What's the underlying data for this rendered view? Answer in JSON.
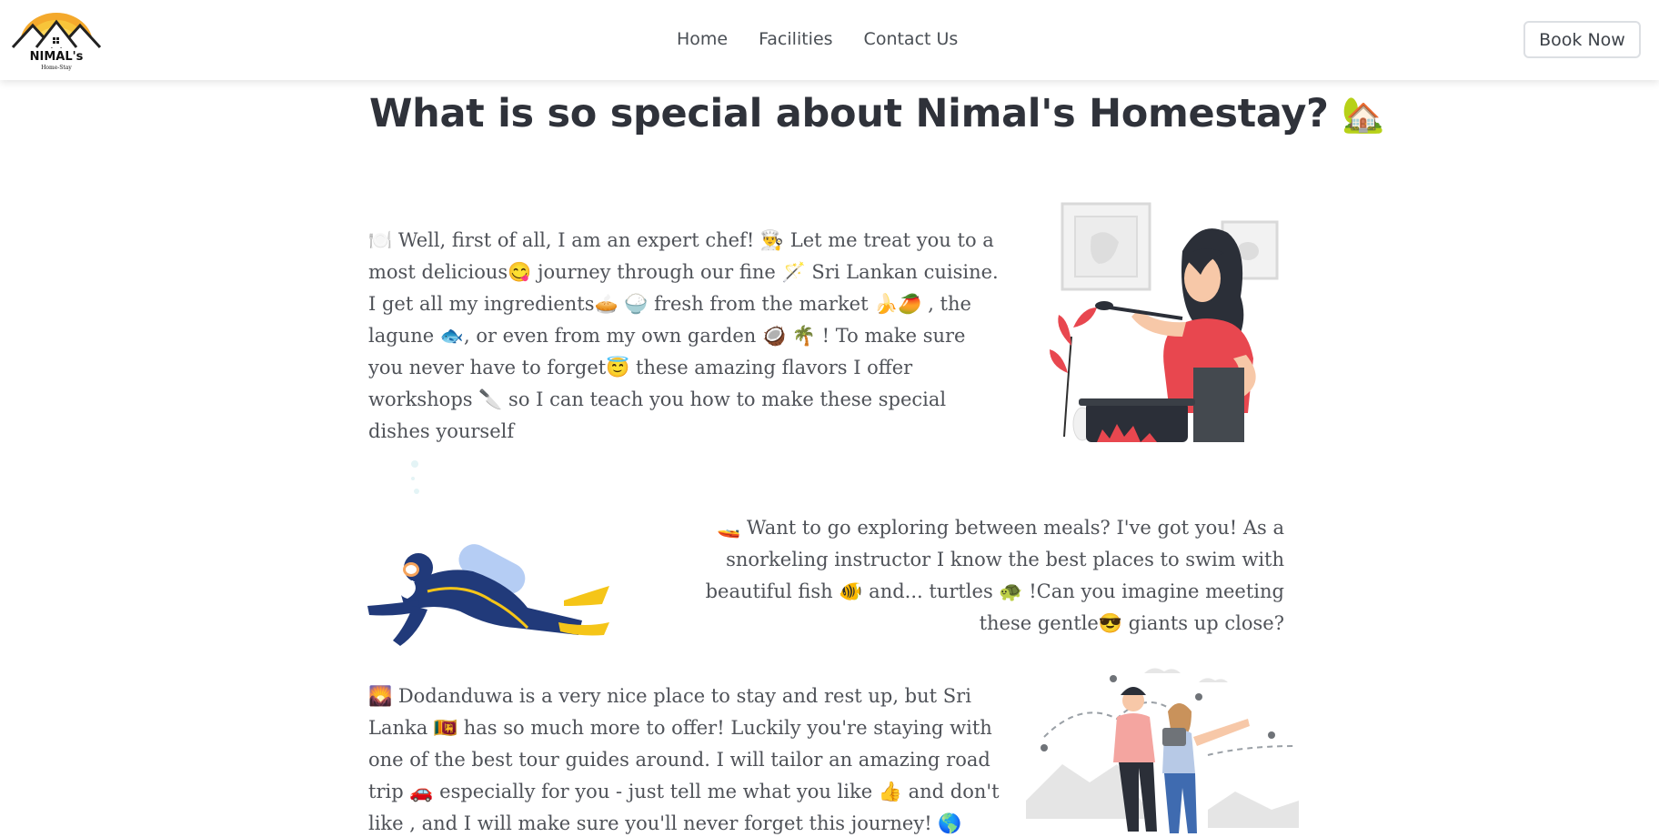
{
  "brand": {
    "name": "NIMAL's",
    "subtitle": "Home-Stay"
  },
  "nav": {
    "items": [
      {
        "label": "Home"
      },
      {
        "label": "Facilities"
      },
      {
        "label": "Contact Us"
      }
    ],
    "book_label": "Book Now"
  },
  "page": {
    "title": "What is so special about Nimal's Homestay?",
    "title_emoji": "🏡"
  },
  "sections": [
    {
      "text": "🍽️ Well, first of all, I am an expert chef! 👨‍🍳 Let me treat you to a most delicious😋 journey through our fine 🪄 Sri Lankan cuisine. I get all my ingredients🥧 🍚 fresh from the market 🍌🥭 , the lagune 🐟, or even from my own garden 🥥 🌴 ! To make sure you never have to forget😇 these amazing flavors I offer workshops 🔪 so I can teach you how to make these special dishes yourself",
      "illustration": "chef-illustration"
    },
    {
      "text": "🚤 Want to go exploring between meals? I've got you! As a snorkeling instructor I know the best places to swim with beautiful fish 🐠 and... turtles 🐢 !Can you imagine meeting these gentle😎 giants up close?",
      "illustration": "diver-illustration"
    },
    {
      "text": "🌄 Dodanduwa is a very nice place to stay and rest up, but Sri Lanka 🇱🇰 has so much more to offer! Luckily you're staying with one of the best tour guides around. I will tailor an amazing road trip 🚗 especially for you - just tell me what you like 👍 and don't like , and I will make sure you'll never forget this journey! 🌎",
      "illustration": "travel-illustration"
    }
  ],
  "colors": {
    "heading": "#2f323a",
    "body_text": "#4f5258",
    "nav_text": "#4a4f55",
    "accent_red": "#e8474f",
    "accent_navy": "#213a7a",
    "accent_yellow": "#f5c518"
  }
}
